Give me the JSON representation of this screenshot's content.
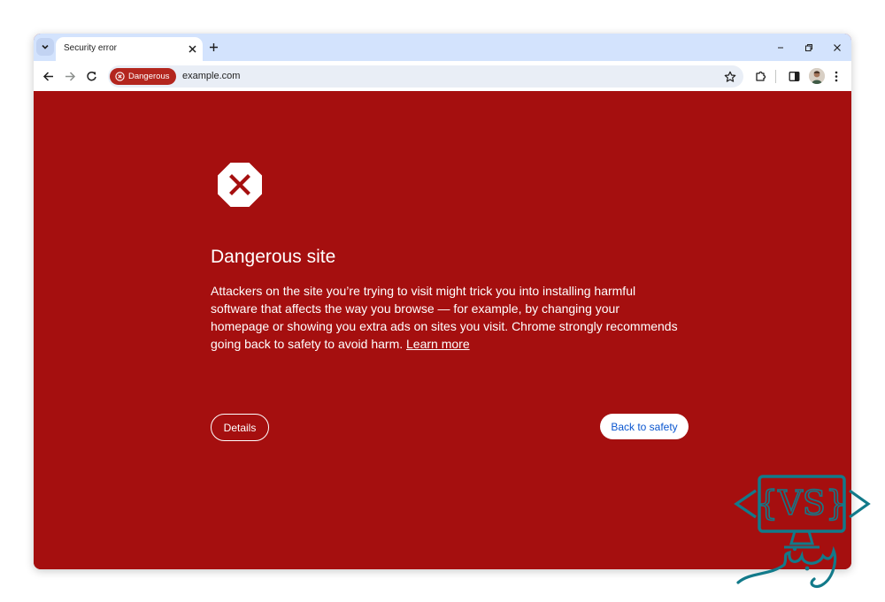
{
  "browser": {
    "tab": {
      "title": "Security error"
    },
    "toolbar": {
      "security_chip": "Dangerous",
      "url": "example.com"
    }
  },
  "interstitial": {
    "heading": "Dangerous site",
    "body": "Attackers on the site you’re trying to visit might trick you into installing harmful software that affects the way you browse — for example, by changing your homepage or showing you extra ads on sites you visit. Chrome strongly recommends going back to safety to avoid harm.",
    "learn_more": "Learn more",
    "details_button": "Details",
    "back_button": "Back to safety"
  },
  "watermark": {
    "logo_text": "{VS}"
  },
  "colors": {
    "danger_background": "#a50f0f",
    "tabstrip": "#d3e3fd",
    "chip": "#b3261e",
    "primary_button_text": "#0b57d0",
    "watermark_teal": "#127a8a"
  },
  "icons": [
    "tab-search-icon",
    "tab-close-icon",
    "new-tab-icon",
    "minimize-icon",
    "restore-icon",
    "close-window-icon",
    "back-arrow-icon",
    "forward-arrow-icon",
    "reload-icon",
    "danger-chip-icon",
    "bookmark-star-icon",
    "extensions-icon",
    "side-panel-icon",
    "profile-avatar",
    "more-menu-icon",
    "danger-octagon-icon"
  ]
}
